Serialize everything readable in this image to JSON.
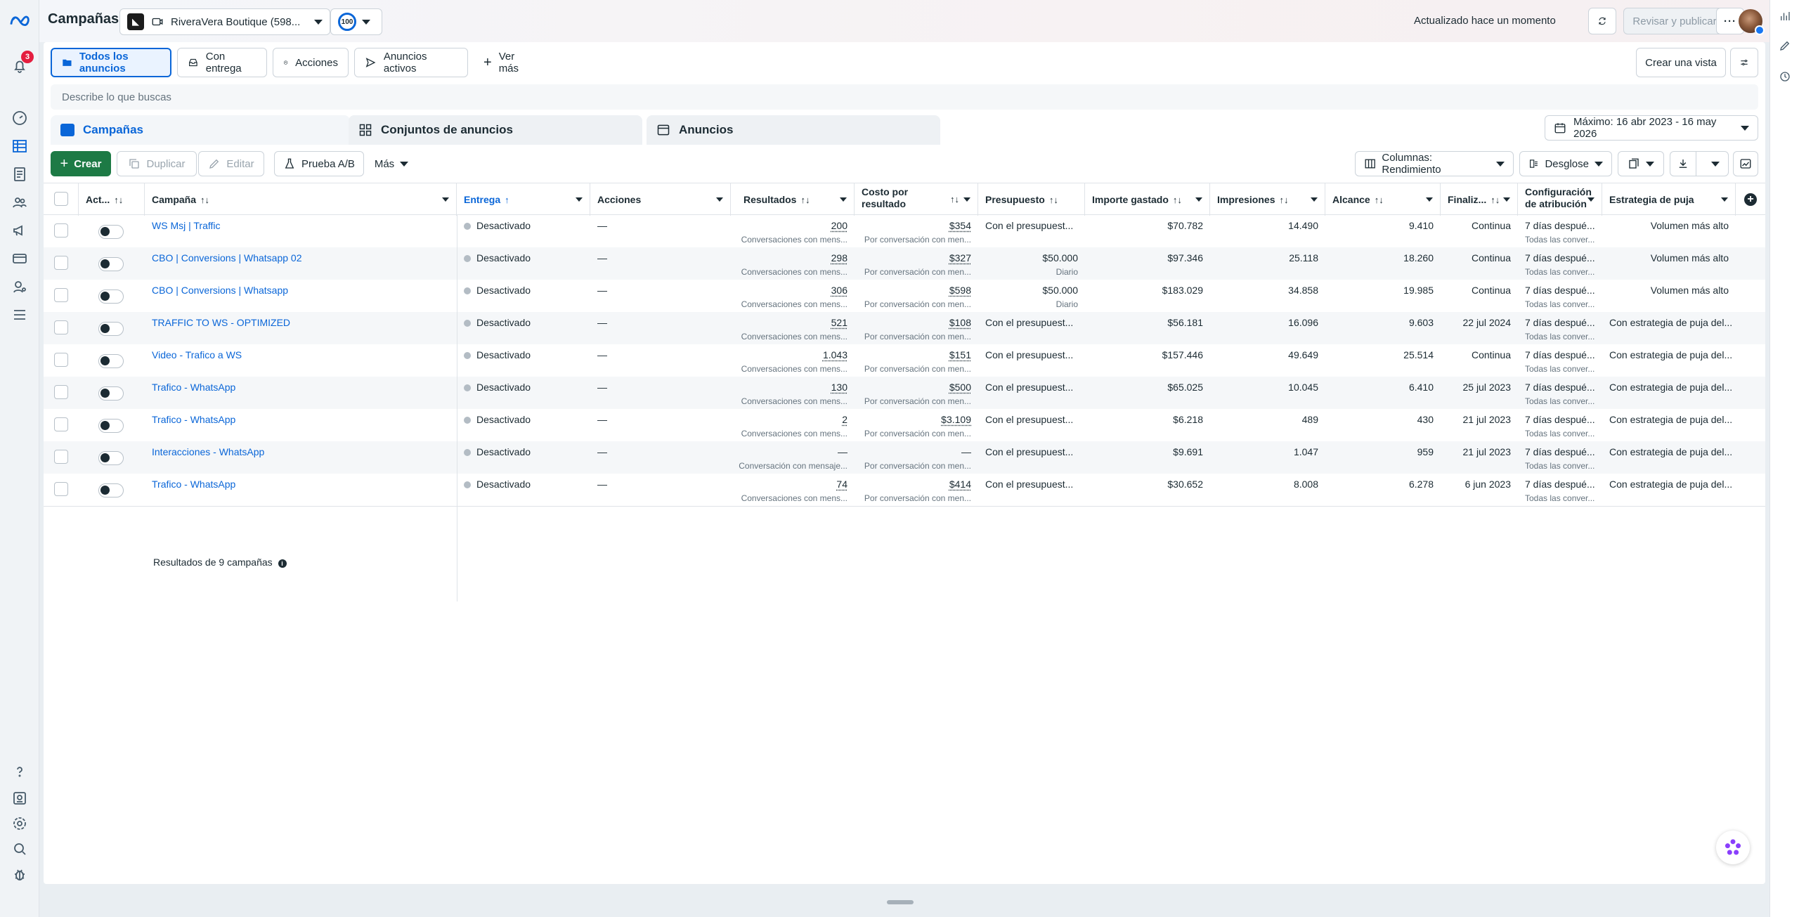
{
  "app": {
    "title": "Campañas"
  },
  "notifications": {
    "count": "3"
  },
  "account": {
    "name": "RiveraVera Boutique (598...",
    "score": "100"
  },
  "topbar": {
    "updated": "Actualizado hace un momento",
    "review_publish": "Revisar y publicar"
  },
  "filters": {
    "all_ads": "Todos los anuncios",
    "with_delivery": "Con entrega",
    "actions": "Acciones",
    "active_ads": "Anuncios activos",
    "see_more": "Ver más",
    "create_view": "Crear una vista"
  },
  "search": {
    "placeholder": "Describe lo que buscas"
  },
  "level_tabs": {
    "campaigns": "Campañas",
    "adsets": "Conjuntos de anuncios",
    "ads": "Anuncios"
  },
  "date_range": "Máximo: 16 abr 2023 - 16 may 2026",
  "toolbar": {
    "create": "Crear",
    "duplicate": "Duplicar",
    "edit": "Editar",
    "ab_test": "Prueba A/B",
    "more": "Más",
    "columns": "Columnas: Rendimiento",
    "breakdown": "Desglose"
  },
  "columns": {
    "active": "Act...",
    "campaign": "Campaña",
    "delivery": "Entrega",
    "actions": "Acciones",
    "results": "Resultados",
    "cpr_1": "Costo por",
    "cpr_2": "resultado",
    "budget": "Presupuesto",
    "spent": "Importe gastado",
    "impressions": "Impresiones",
    "reach": "Alcance",
    "ends": "Finaliz...",
    "attr_1": "Configuración",
    "attr_2": "de atribución",
    "bid": "Estrategia de puja"
  },
  "rows": [
    {
      "name": "WS Msj | Traffic",
      "delivery": "Desactivado",
      "actions": "—",
      "results": "200",
      "results_sub": "Conversaciones con mens...",
      "cpr": "$354",
      "cpr_sub": "Por conversación con men...",
      "budget": "Con el presupuest...",
      "budget_sub": "",
      "spent": "$70.782",
      "impressions": "14.490",
      "reach": "9.410",
      "ends": "Continua",
      "attr": "7 días despué...",
      "attr_sub": "Todas las conver...",
      "bid": "Volumen más alto",
      "bid_right": true
    },
    {
      "name": "CBO | Conversions | Whatsapp 02",
      "delivery": "Desactivado",
      "actions": "—",
      "results": "298",
      "results_sub": "Conversaciones con mens...",
      "cpr": "$327",
      "cpr_sub": "Por conversación con men...",
      "budget": "$50.000",
      "budget_sub": "Diario",
      "spent": "$97.346",
      "impressions": "25.118",
      "reach": "18.260",
      "ends": "Continua",
      "attr": "7 días despué...",
      "attr_sub": "Todas las conver...",
      "bid": "Volumen más alto",
      "bid_right": true
    },
    {
      "name": "CBO | Conversions | Whatsapp",
      "delivery": "Desactivado",
      "actions": "—",
      "results": "306",
      "results_sub": "Conversaciones con mens...",
      "cpr": "$598",
      "cpr_sub": "Por conversación con men...",
      "budget": "$50.000",
      "budget_sub": "Diario",
      "spent": "$183.029",
      "impressions": "34.858",
      "reach": "19.985",
      "ends": "Continua",
      "attr": "7 días despué...",
      "attr_sub": "Todas las conver...",
      "bid": "Volumen más alto",
      "bid_right": true
    },
    {
      "name": "TRAFFIC TO WS - OPTIMIZED",
      "delivery": "Desactivado",
      "actions": "—",
      "results": "521",
      "results_sub": "Conversaciones con mens...",
      "cpr": "$108",
      "cpr_sub": "Por conversación con men...",
      "budget": "Con el presupuest...",
      "budget_sub": "",
      "spent": "$56.181",
      "impressions": "16.096",
      "reach": "9.603",
      "ends": "22 jul 2024",
      "attr": "7 días despué...",
      "attr_sub": "Todas las conver...",
      "bid": "Con estrategia de puja del...",
      "bid_right": false
    },
    {
      "name": "Video - Trafico a WS",
      "delivery": "Desactivado",
      "actions": "—",
      "results": "1.043",
      "results_sub": "Conversaciones con mens...",
      "cpr": "$151",
      "cpr_sub": "Por conversación con men...",
      "budget": "Con el presupuest...",
      "budget_sub": "",
      "spent": "$157.446",
      "impressions": "49.649",
      "reach": "25.514",
      "ends": "Continua",
      "attr": "7 días despué...",
      "attr_sub": "Todas las conver...",
      "bid": "Con estrategia de puja del...",
      "bid_right": false
    },
    {
      "name": "Trafico - WhatsApp",
      "delivery": "Desactivado",
      "actions": "—",
      "results": "130",
      "results_sub": "Conversaciones con mens...",
      "cpr": "$500",
      "cpr_sub": "Por conversación con men...",
      "budget": "Con el presupuest...",
      "budget_sub": "",
      "spent": "$65.025",
      "impressions": "10.045",
      "reach": "6.410",
      "ends": "25 jul 2023",
      "attr": "7 días despué...",
      "attr_sub": "Todas las conver...",
      "bid": "Con estrategia de puja del...",
      "bid_right": false
    },
    {
      "name": "Trafico - WhatsApp",
      "delivery": "Desactivado",
      "actions": "—",
      "results": "2",
      "results_sub": "Conversaciones con mens...",
      "cpr": "$3.109",
      "cpr_sub": "Por conversación con men...",
      "budget": "Con el presupuest...",
      "budget_sub": "",
      "spent": "$6.218",
      "impressions": "489",
      "reach": "430",
      "ends": "21 jul 2023",
      "attr": "7 días despué...",
      "attr_sub": "Todas las conver...",
      "bid": "Con estrategia de puja del...",
      "bid_right": false
    },
    {
      "name": "Interacciones - WhatsApp",
      "delivery": "Desactivado",
      "actions": "—",
      "results": "—",
      "results_sub": "Conversación con mensaje...",
      "cpr": "—",
      "cpr_sub": "Por conversación con men...",
      "budget": "Con el presupuest...",
      "budget_sub": "",
      "spent": "$9.691",
      "impressions": "1.047",
      "reach": "959",
      "ends": "21 jul 2023",
      "attr": "7 días despué...",
      "attr_sub": "Todas las conver...",
      "bid": "Con estrategia de puja del...",
      "bid_right": false
    },
    {
      "name": "Trafico - WhatsApp",
      "delivery": "Desactivado",
      "actions": "—",
      "results": "74",
      "results_sub": "Conversaciones con mens...",
      "cpr": "$414",
      "cpr_sub": "Por conversación con men...",
      "budget": "Con el presupuest...",
      "budget_sub": "",
      "spent": "$30.652",
      "impressions": "8.008",
      "reach": "6.278",
      "ends": "6 jun 2023",
      "attr": "7 días despué...",
      "attr_sub": "Todas las conver...",
      "bid": "Con estrategia de puja del...",
      "bid_right": false
    }
  ],
  "footer": {
    "results_text": "Resultados de 9 campañas"
  }
}
